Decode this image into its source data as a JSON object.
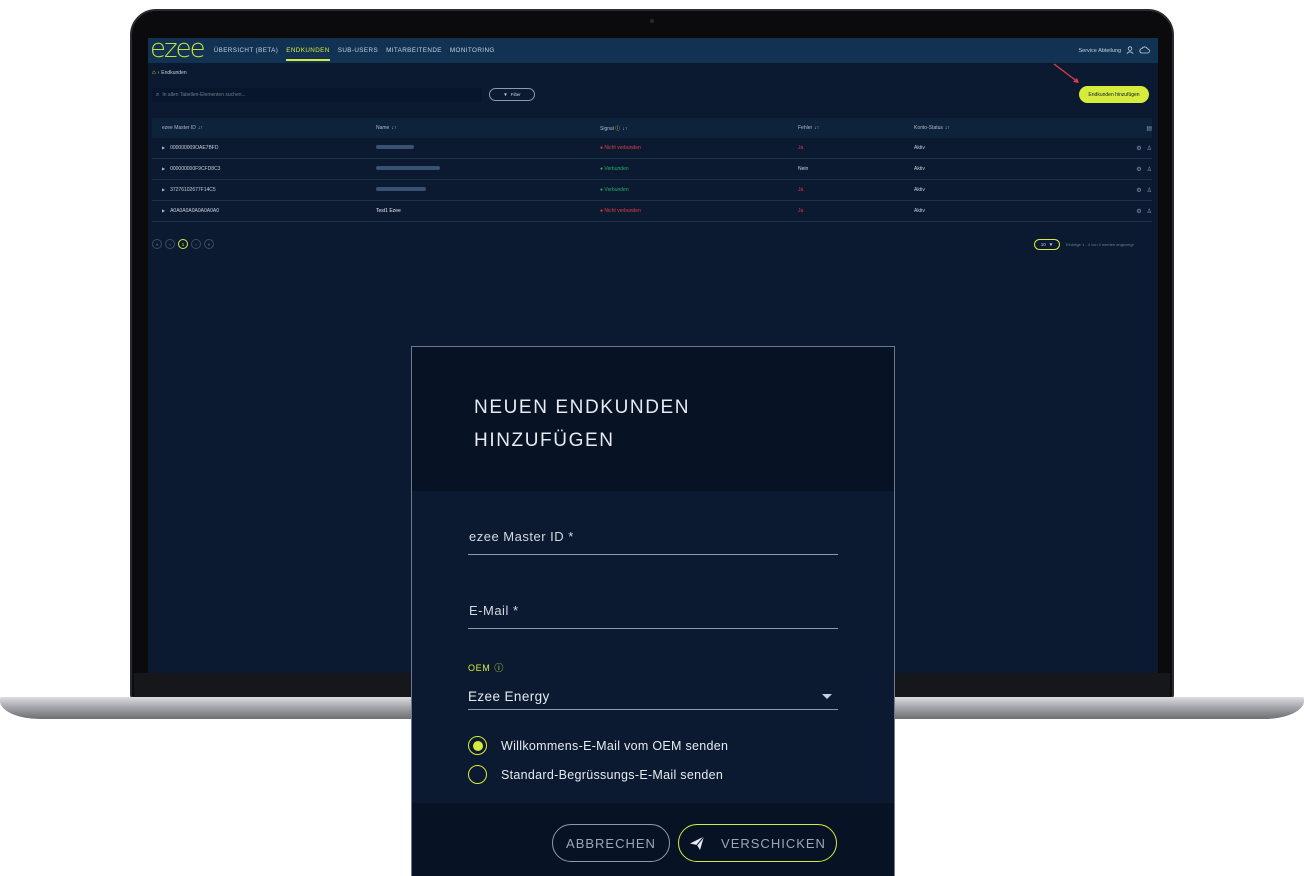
{
  "app": {
    "logo": "ezee",
    "nav": [
      {
        "label": "ÜBERSICHT (BETA)",
        "active": false
      },
      {
        "label": "ENDKUNDEN",
        "active": true
      },
      {
        "label": "SUB-USERS",
        "active": false
      },
      {
        "label": "MITARBEITENDE",
        "active": false
      },
      {
        "label": "MONITORING",
        "active": false
      }
    ],
    "user_name": "Service Abteilung",
    "breadcrumb": "Endkunden",
    "search_placeholder": "In allen Tabellen-Elementen suchen...",
    "filter_label": "Filter",
    "add_button": "Endkunden hinzufügen",
    "accent_color": "#d6ec3c"
  },
  "table": {
    "columns": [
      "ezee Master ID",
      "Name",
      "Signal",
      "Fehler",
      "Konto-Status"
    ],
    "rows": [
      {
        "id": "000000009OAE7BFD",
        "name": "",
        "signal": "Nicht verbunden",
        "signal_state": "red",
        "fehler": "Ja",
        "fehler_state": "red",
        "status": "Aktiv"
      },
      {
        "id": "000000000F9CFD8C3",
        "name": "",
        "signal": "Verbunden",
        "signal_state": "green",
        "fehler": "Nein",
        "fehler_state": "normal",
        "status": "Aktiv"
      },
      {
        "id": "37276102677F14C5",
        "name": "",
        "signal": "Verbunden",
        "signal_state": "green",
        "fehler": "Ja",
        "fehler_state": "red",
        "status": "Aktiv"
      },
      {
        "id": "A0A0A0A0A0A0A0A0",
        "name": "Test1 Ezee",
        "signal": "Nicht verbunden",
        "signal_state": "red",
        "fehler": "Ja",
        "fehler_state": "red",
        "status": "Aktiv"
      }
    ],
    "current_page": "1",
    "page_size": "10",
    "page_info": "Einträge 1 - 4 von 4 werden angezeigt"
  },
  "modal": {
    "title": "NEUEN ENDKUNDEN HINZUFÜGEN",
    "master_id_label": "ezee Master ID *",
    "email_label": "E-Mail *",
    "oem_label": "OEM",
    "oem_value": "Ezee Energy",
    "radio_1": "Willkommens-E-Mail vom OEM senden",
    "radio_2": "Standard-Begrüssungs-E-Mail senden",
    "radio_selected": 1,
    "cancel_label": "ABBRECHEN",
    "send_label": "VERSCHICKEN"
  }
}
